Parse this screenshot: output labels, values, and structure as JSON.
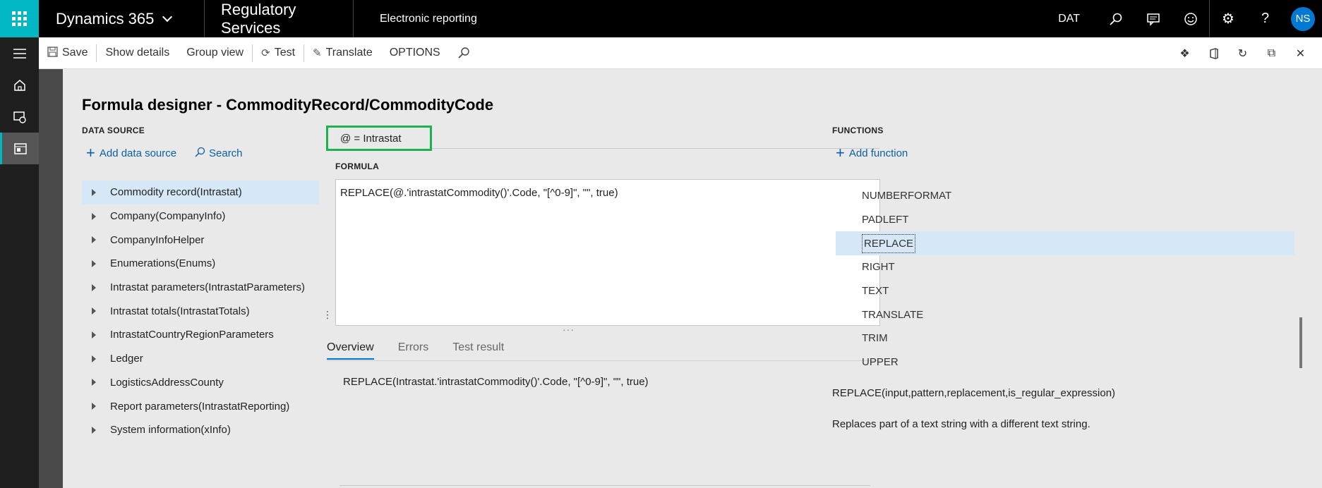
{
  "topbar": {
    "brand": "Dynamics 365",
    "module": "Regulatory Services",
    "breadcrumb": "Electronic reporting",
    "company": "DAT",
    "user_initials": "NS"
  },
  "actions": {
    "save": "Save",
    "show_details": "Show details",
    "group_view": "Group view",
    "test": "Test",
    "translate": "Translate",
    "options": "OPTIONS"
  },
  "page": {
    "title": "Formula designer - CommodityRecord/CommodityCode"
  },
  "datasource": {
    "heading": "DATA SOURCE",
    "add_label": "Add data source",
    "search_label": "Search",
    "items": [
      "Commodity record(Intrastat)",
      "Company(CompanyInfo)",
      "CompanyInfoHelper",
      "Enumerations(Enums)",
      "Intrastat parameters(IntrastatParameters)",
      "Intrastat totals(IntrastatTotals)",
      "IntrastatCountryRegionParameters",
      "Ledger",
      "LogisticsAddressCounty",
      "Report parameters(IntrastatReporting)",
      "System information(xInfo)"
    ]
  },
  "formula": {
    "context": "@ = Intrastat",
    "heading": "FORMULA",
    "text": "REPLACE(@.'intrastatCommodity()'.Code, \"[^0-9]\", \"\", true)",
    "tabs": [
      "Overview",
      "Errors",
      "Test result"
    ],
    "overview_text": "REPLACE(Intrastat.'intrastatCommodity()'.Code, \"[^0-9]\", \"\", true)"
  },
  "functions": {
    "heading": "FUNCTIONS",
    "add_label": "Add function",
    "items": [
      "NUMBERFORMAT",
      "PADLEFT",
      "REPLACE",
      "RIGHT",
      "TEXT",
      "TRANSLATE",
      "TRIM",
      "UPPER"
    ],
    "selected_index": 2,
    "syntax": "REPLACE(input,pattern,replacement,is_regular_expression)",
    "description": "Replaces part of a text string with a different text string."
  }
}
